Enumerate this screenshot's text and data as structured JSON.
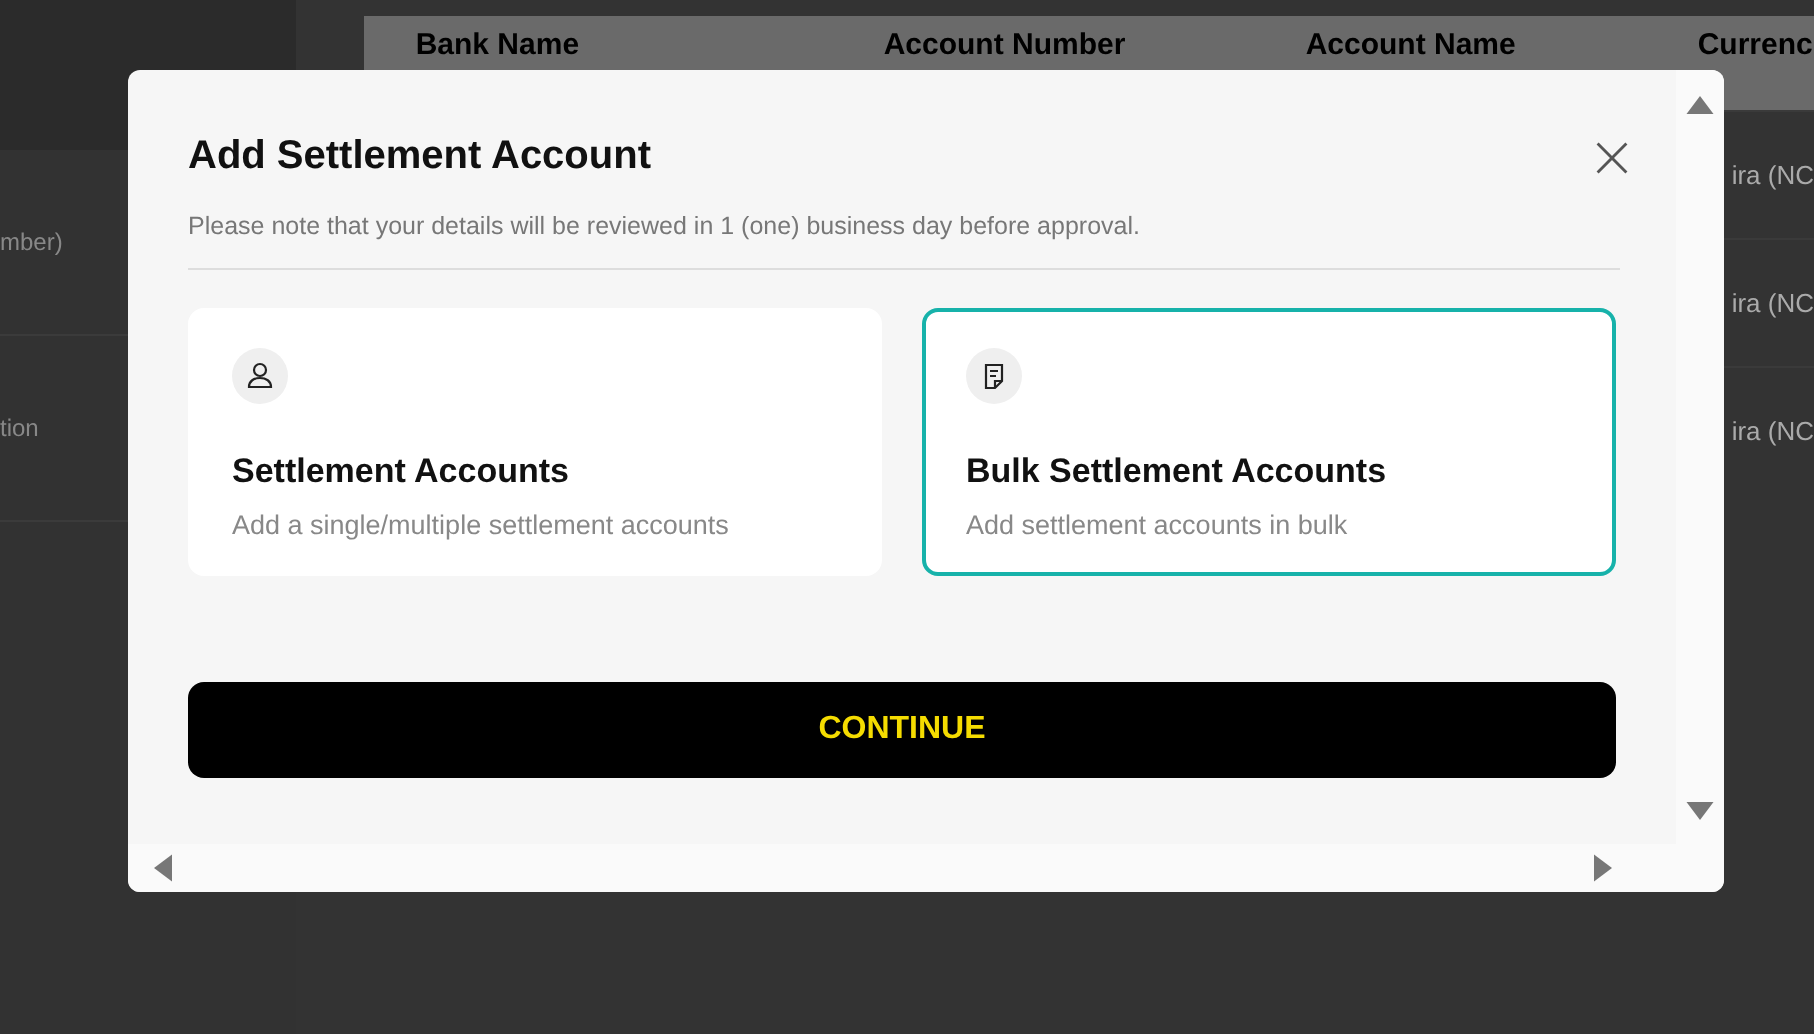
{
  "background": {
    "side_texts": [
      "mber)",
      "tion"
    ],
    "table": {
      "columns": [
        "Bank Name",
        "Account Number",
        "Account Name",
        "Currenc"
      ],
      "rows": [
        {
          "column_4": "ira (NC"
        },
        {
          "column_4": "ira (NC"
        },
        {
          "column_4": "ira (NC"
        }
      ]
    }
  },
  "dialog": {
    "title": "Add Settlement Account",
    "note": "Please note that your details will be reviewed in 1 (one) business day before approval.",
    "options": [
      {
        "kind": "single",
        "title": "Settlement Accounts",
        "description": "Add a single/multiple settlement accounts",
        "selected": false
      },
      {
        "kind": "bulk",
        "title": "Bulk Settlement Accounts",
        "description": "Add settlement accounts in bulk",
        "selected": true
      }
    ],
    "button": "CONTINUE"
  }
}
